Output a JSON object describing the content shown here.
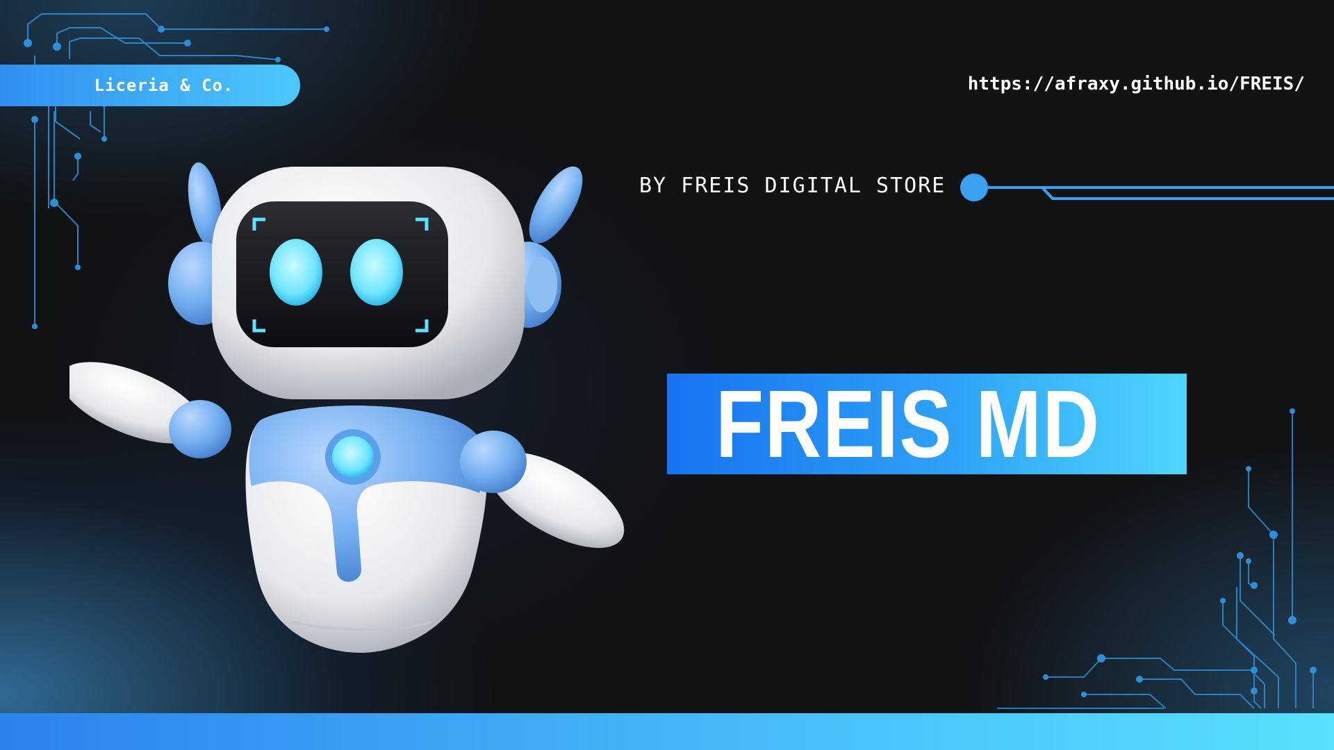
{
  "brand": {
    "label": "Liceria & Co."
  },
  "header": {
    "url": "https://afraxy.github.io/FREIS/"
  },
  "byline": {
    "text": "BY FREIS DIGITAL STORE"
  },
  "hero": {
    "title": "FREIS MD"
  },
  "illustration": {
    "subject": "robot-mascot"
  },
  "colors": {
    "background": "#111214",
    "accent_blue": "#2f8ff0",
    "accent_cyan": "#4fd6fd",
    "circuit": "#2e8fd8",
    "text": "#ffffff"
  }
}
